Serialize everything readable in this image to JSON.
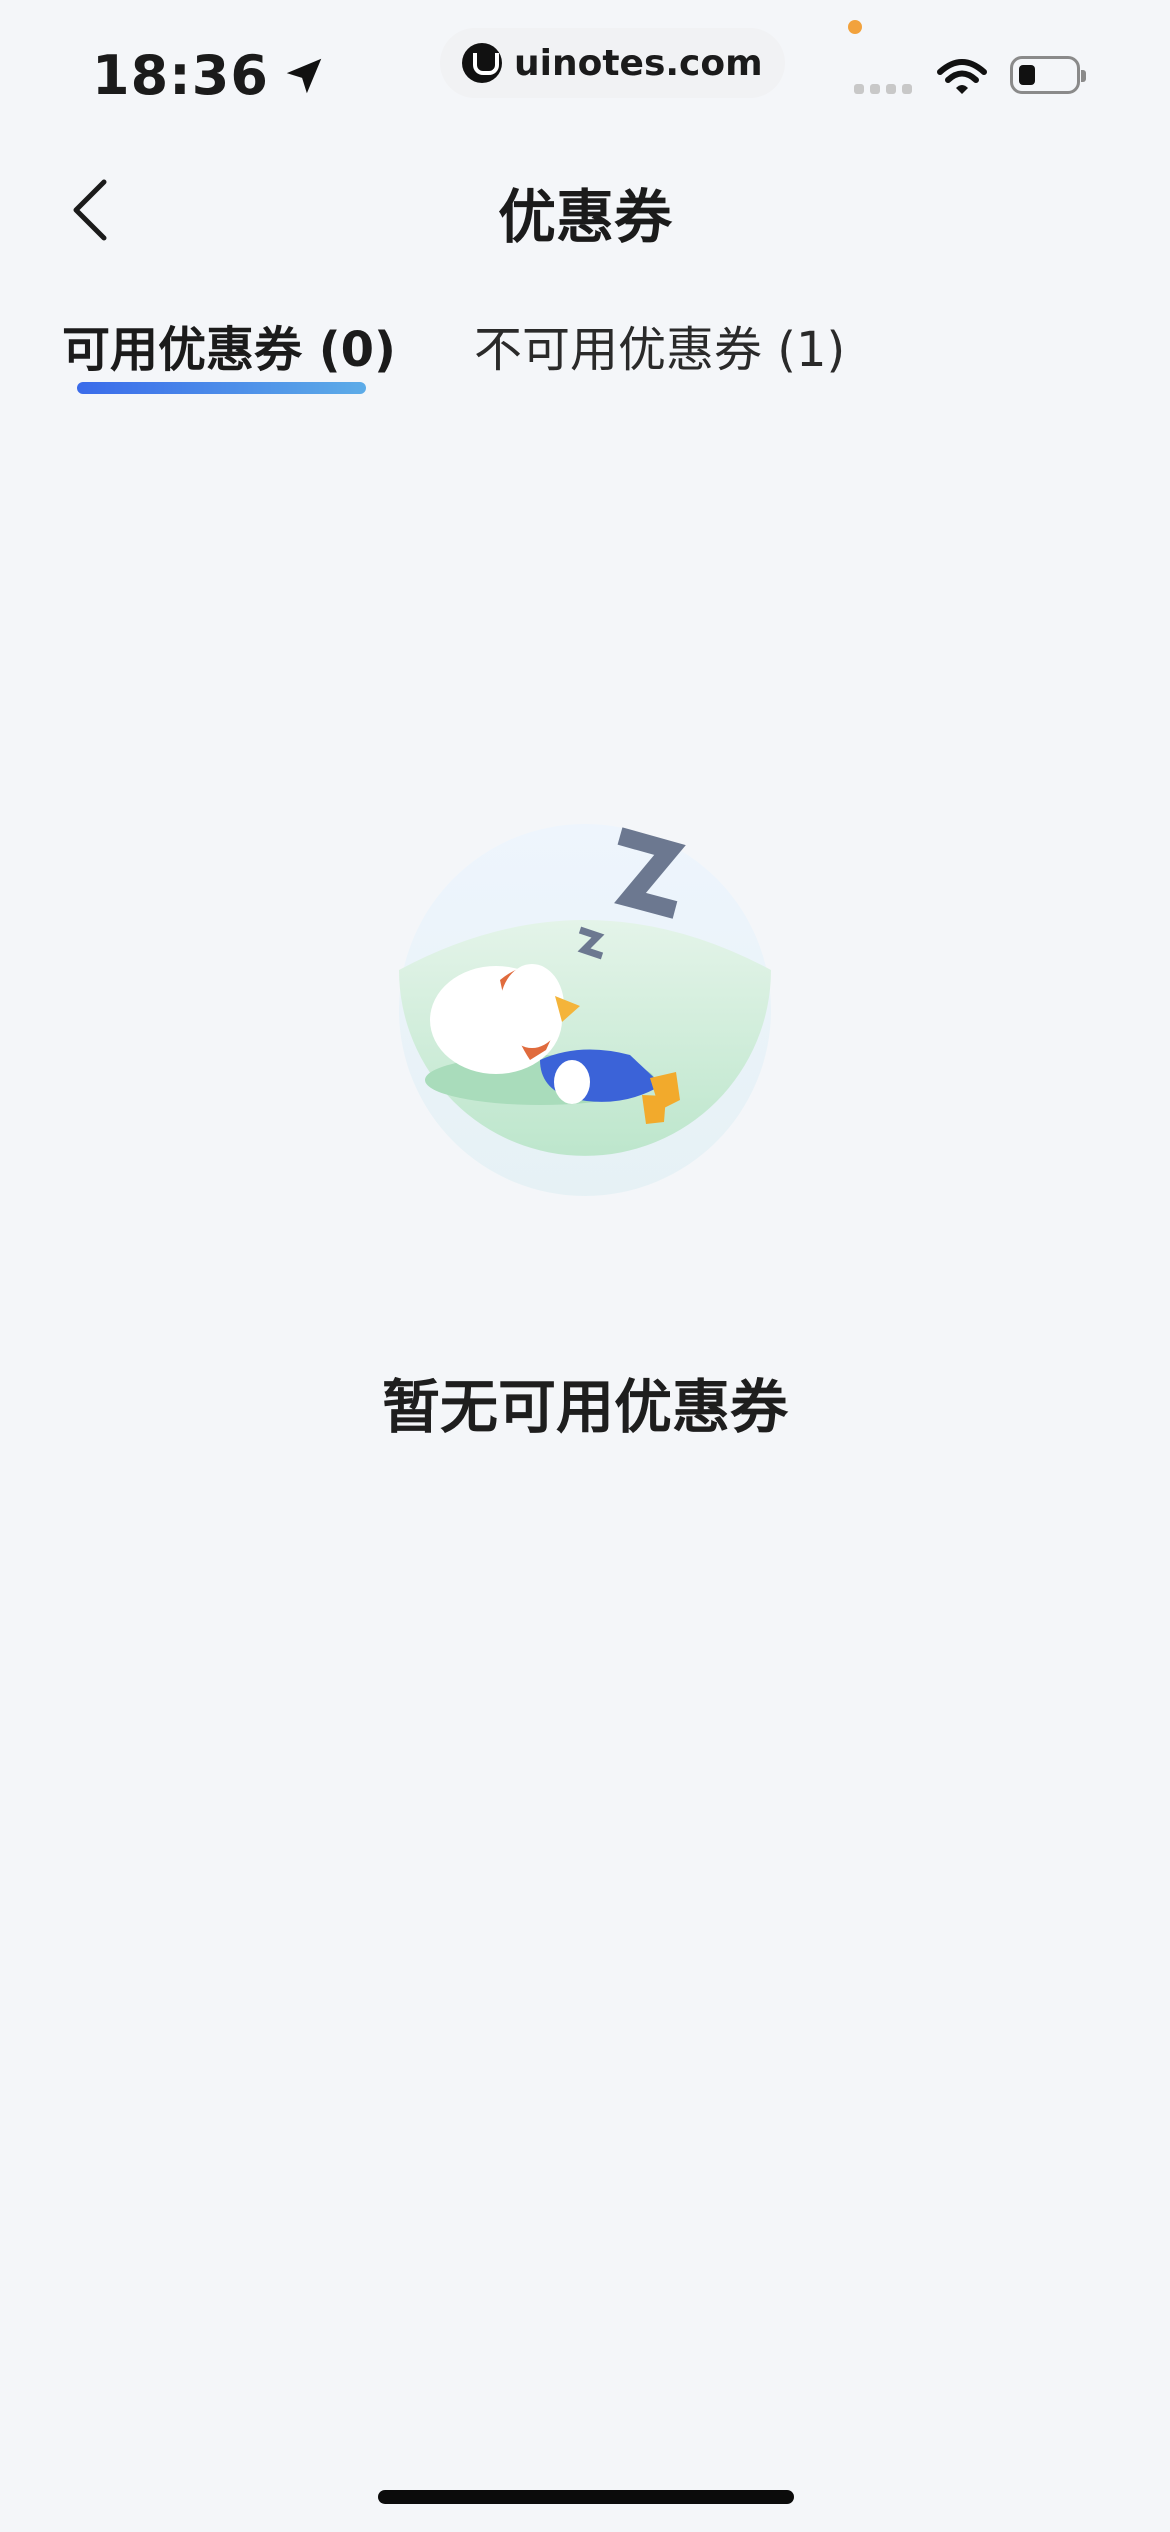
{
  "status_bar": {
    "time": "18:36",
    "url": "uinotes.com"
  },
  "nav": {
    "title": "优惠券"
  },
  "tabs": [
    {
      "label": "可用优惠券 (0)",
      "active": true
    },
    {
      "label": "不可用优惠券 (1)",
      "active": false
    }
  ],
  "empty_state": {
    "message": "暂无可用优惠券",
    "illustration": "sleeping-character-icon"
  },
  "colors": {
    "background": "#f4f6f9",
    "tab_indicator_start": "#3a6bea",
    "tab_indicator_end": "#5dace8"
  }
}
